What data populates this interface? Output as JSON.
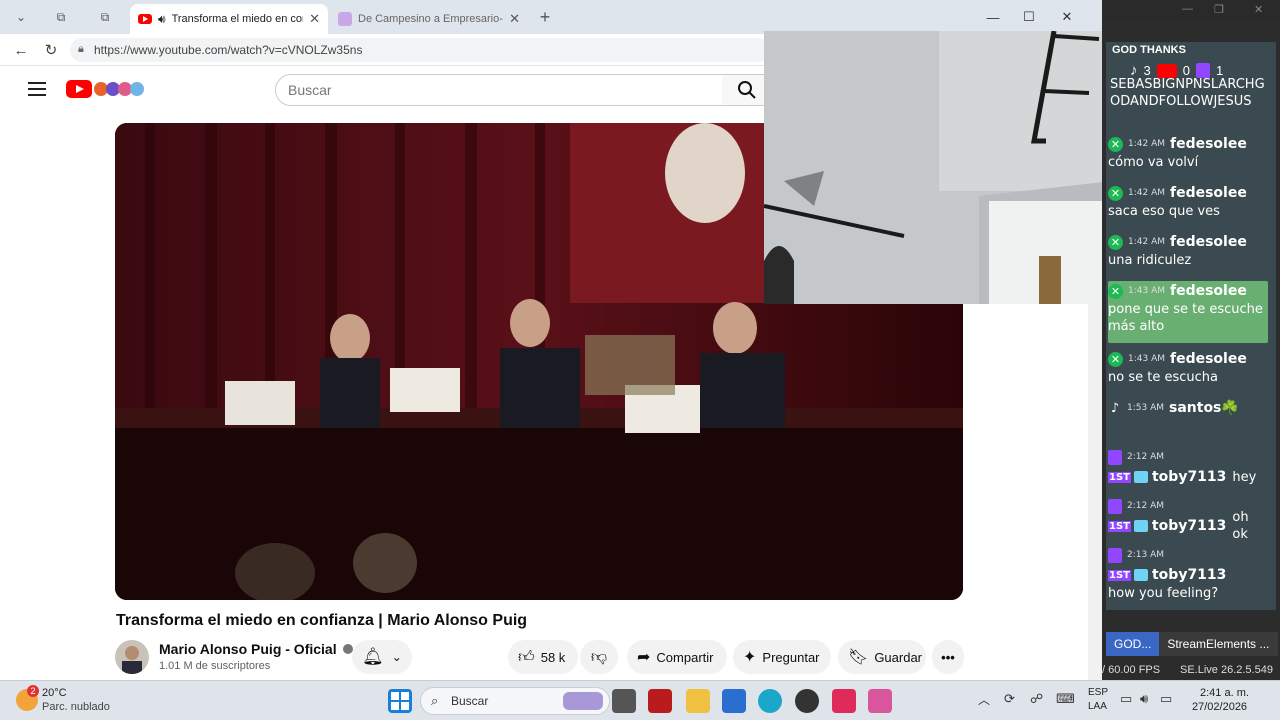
{
  "browser": {
    "tabs": [
      {
        "title": "Transforma el miedo en confianza",
        "active": true
      },
      {
        "title": "De Campesino a Empresario- cóm",
        "active": false
      }
    ],
    "url": "https://www.youtube.com/watch?v=cVNOLZw35ns"
  },
  "youtube": {
    "search_placeholder": "Buscar",
    "video_title": "Transforma el miedo en confianza | Mario Alonso Puig",
    "channel_name": "Mario Alonso Puig - Oficial",
    "subscribers": "1.01 M de suscriptores",
    "likes": "58 k",
    "share_label": "Compartir",
    "ask_label": "Preguntar",
    "save_label": "Guardar"
  },
  "stream": {
    "header_label": "GOD THANKS",
    "counts": {
      "tiktok": "3",
      "youtube": "0",
      "twitch": "1"
    },
    "pinned_text": "SEBASBIGNPNSLARCHGODANDFOLLOWJESUS",
    "messages": [
      {
        "platform": "green",
        "time": "1:42 AM",
        "user": "fedesolee",
        "text": "cómo va volví"
      },
      {
        "platform": "green",
        "time": "1:42 AM",
        "user": "fedesolee",
        "text": "saca eso que ves"
      },
      {
        "platform": "green",
        "time": "1:42 AM",
        "user": "fedesolee",
        "text": "una ridiculez"
      },
      {
        "platform": "green",
        "time": "1:43 AM",
        "user": "fedesolee",
        "text": "pone que se te escuche más alto",
        "highlight": true
      },
      {
        "platform": "green",
        "time": "1:43 AM",
        "user": "fedesolee",
        "text": "no se te escucha"
      },
      {
        "platform": "tiktok",
        "time": "1:53 AM",
        "user": "santos☘️",
        "text": ""
      },
      {
        "platform": "twitch",
        "time": "2:12 AM",
        "user": "toby7113",
        "text": "hey",
        "inline": true
      },
      {
        "platform": "twitch",
        "time": "2:12 AM",
        "user": "toby7113",
        "text": "oh ok",
        "inline": true
      },
      {
        "platform": "twitch",
        "time": "2:13 AM",
        "user": "toby7113",
        "text": "how you feeling?"
      }
    ],
    "dock_tabs": [
      "GOD...",
      "StreamElements ..."
    ],
    "fps": "/ 60.00 FPS",
    "version": "SE.Live 26.2.5.549"
  },
  "taskbar": {
    "weather_temp": "20°C",
    "weather_desc": "Parc. nublado",
    "weather_badge": "2",
    "search_label": "Buscar",
    "lang_top": "ESP",
    "lang_bottom": "LAA",
    "time": "2:41 a. m.",
    "date": "27/02/2026"
  },
  "colors": {
    "youtube_red": "#ff0000",
    "twitch_purple": "#9146ff",
    "chat_bg": "#3a4a50",
    "highlight_green": "#6aaf72"
  }
}
